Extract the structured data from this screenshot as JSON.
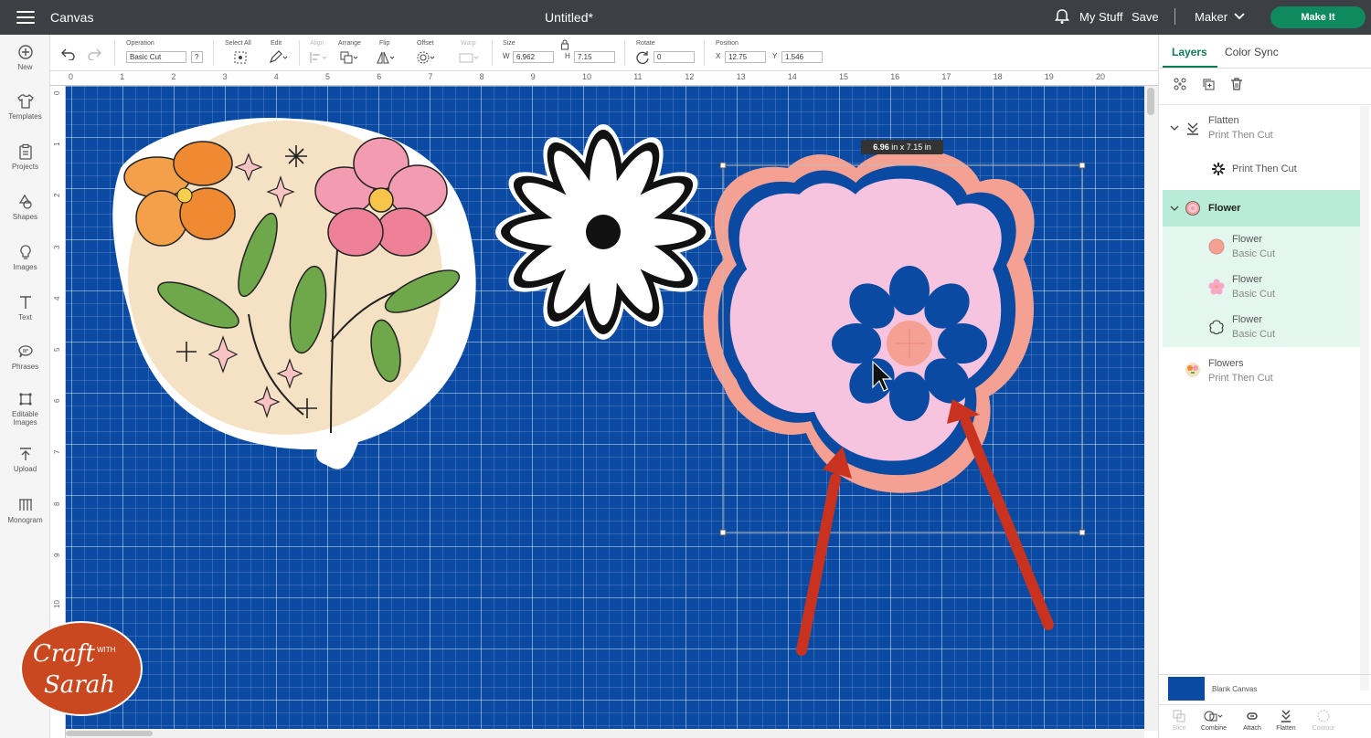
{
  "header": {
    "app_title": "Canvas",
    "doc_title": "Untitled*",
    "my_stuff": "My Stuff",
    "save": "Save",
    "machine": "Maker",
    "make_it": "Make It"
  },
  "leftnav": [
    {
      "label": "New",
      "icon": "plus-circle-icon"
    },
    {
      "label": "Templates",
      "icon": "shirt-icon"
    },
    {
      "label": "Projects",
      "icon": "clipboard-icon"
    },
    {
      "label": "Shapes",
      "icon": "shapes-icon"
    },
    {
      "label": "Images",
      "icon": "lightbulb-icon"
    },
    {
      "label": "Text",
      "icon": "text-icon"
    },
    {
      "label": "Phrases",
      "icon": "speech-bubble-icon"
    },
    {
      "label": "Editable Images",
      "icon": "edit-image-icon"
    },
    {
      "label": "Upload",
      "icon": "upload-icon"
    },
    {
      "label": "Monogram",
      "icon": "monogram-icon"
    }
  ],
  "toolbar": {
    "operation_label": "Operation",
    "operation_value": "Basic Cut",
    "help": "?",
    "select_all": "Select All",
    "edit": "Edit",
    "align": "Align",
    "arrange": "Arrange",
    "flip": "Flip",
    "offset": "Offset",
    "warp": "Warp",
    "size_label": "Size",
    "w_label": "W",
    "w_value": "6.962",
    "h_label": "H",
    "h_value": "7.15",
    "rotate_label": "Rotate",
    "rotate_value": "0",
    "position_label": "Position",
    "x_label": "X",
    "x_value": "12.75",
    "y_label": "Y",
    "y_value": "1.546"
  },
  "ruler": {
    "top": [
      "0",
      "1",
      "2",
      "3",
      "4",
      "5",
      "6",
      "7",
      "8",
      "9",
      "10",
      "11",
      "12",
      "13",
      "14",
      "15",
      "16",
      "17",
      "18",
      "19",
      "20"
    ],
    "left": [
      "0",
      "1",
      "2",
      "3",
      "4",
      "5",
      "6",
      "7",
      "8",
      "9",
      "10"
    ]
  },
  "canvas": {
    "size_tooltip_w": "6.96",
    "size_tooltip_rest": "in x 7.15  in",
    "zoom": "100%",
    "bg_color": "#0a4aa3"
  },
  "panel": {
    "tab_layers": "Layers",
    "tab_color_sync": "Color Sync",
    "layers": [
      {
        "name": "Flatten",
        "sub": "Print Then Cut",
        "kind": "group"
      },
      {
        "name": "Print Then Cut",
        "sub": "",
        "kind": "child"
      },
      {
        "name": "Flower",
        "sub": "",
        "kind": "group-selected"
      },
      {
        "name": "Flower",
        "sub": "Basic Cut",
        "kind": "child-selected"
      },
      {
        "name": "Flower",
        "sub": "Basic Cut",
        "kind": "child-selected"
      },
      {
        "name": "Flower",
        "sub": "Basic Cut",
        "kind": "child-selected"
      },
      {
        "name": "Flowers",
        "sub": "Print Then Cut",
        "kind": "single"
      }
    ],
    "blank_canvas": "Blank Canvas",
    "bottom_tools": [
      "Slice",
      "Combine",
      "Attach",
      "Flatten",
      "Contour"
    ]
  },
  "logo": {
    "line1": "Craft",
    "with": "WITH",
    "line2": "Sarah"
  },
  "colors": {
    "accent": "#0f8a5f",
    "arrow": "#c8321e",
    "flower_outer": "#f4a093",
    "flower_inner": "#f7c4e0"
  }
}
